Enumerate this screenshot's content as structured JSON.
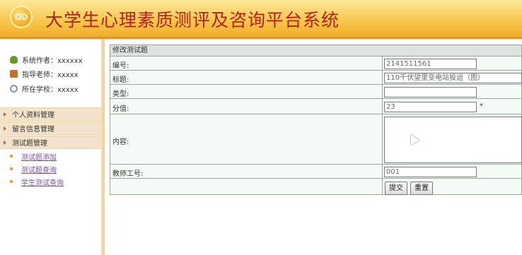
{
  "header": {
    "logo_text": "OD",
    "title": "大学生心理素质测评及咨询平台系统"
  },
  "sidebar": {
    "info": [
      {
        "icon": "user-icon",
        "text": "系统作者：xxxxxx"
      },
      {
        "icon": "teacher-icon",
        "text": "指导老师：xxxxx"
      },
      {
        "icon": "school-icon",
        "text": "所在学校：xxxxx"
      }
    ],
    "groups": [
      {
        "label": "个人资料管理"
      },
      {
        "label": "留言信息管理"
      },
      {
        "label": "测试题管理"
      }
    ],
    "subitems": [
      {
        "label": "测试题添加"
      },
      {
        "label": "测试题查询"
      },
      {
        "label": "学生测试查询"
      }
    ]
  },
  "form": {
    "title": "修改测试题",
    "fields": {
      "number": {
        "label": "编号:",
        "value": "2141511561"
      },
      "title": {
        "label": "标题:",
        "value": "110千伏望里变电站投运（图）"
      },
      "type": {
        "label": "类型:",
        "value": ""
      },
      "score": {
        "label": "分值:",
        "value": "23",
        "required": "*"
      },
      "content": {
        "label": "内容:",
        "value": ""
      },
      "teacher_no": {
        "label": "教师工号:",
        "value": "001"
      }
    },
    "submit_label": "提交",
    "reset_label": "重置"
  }
}
